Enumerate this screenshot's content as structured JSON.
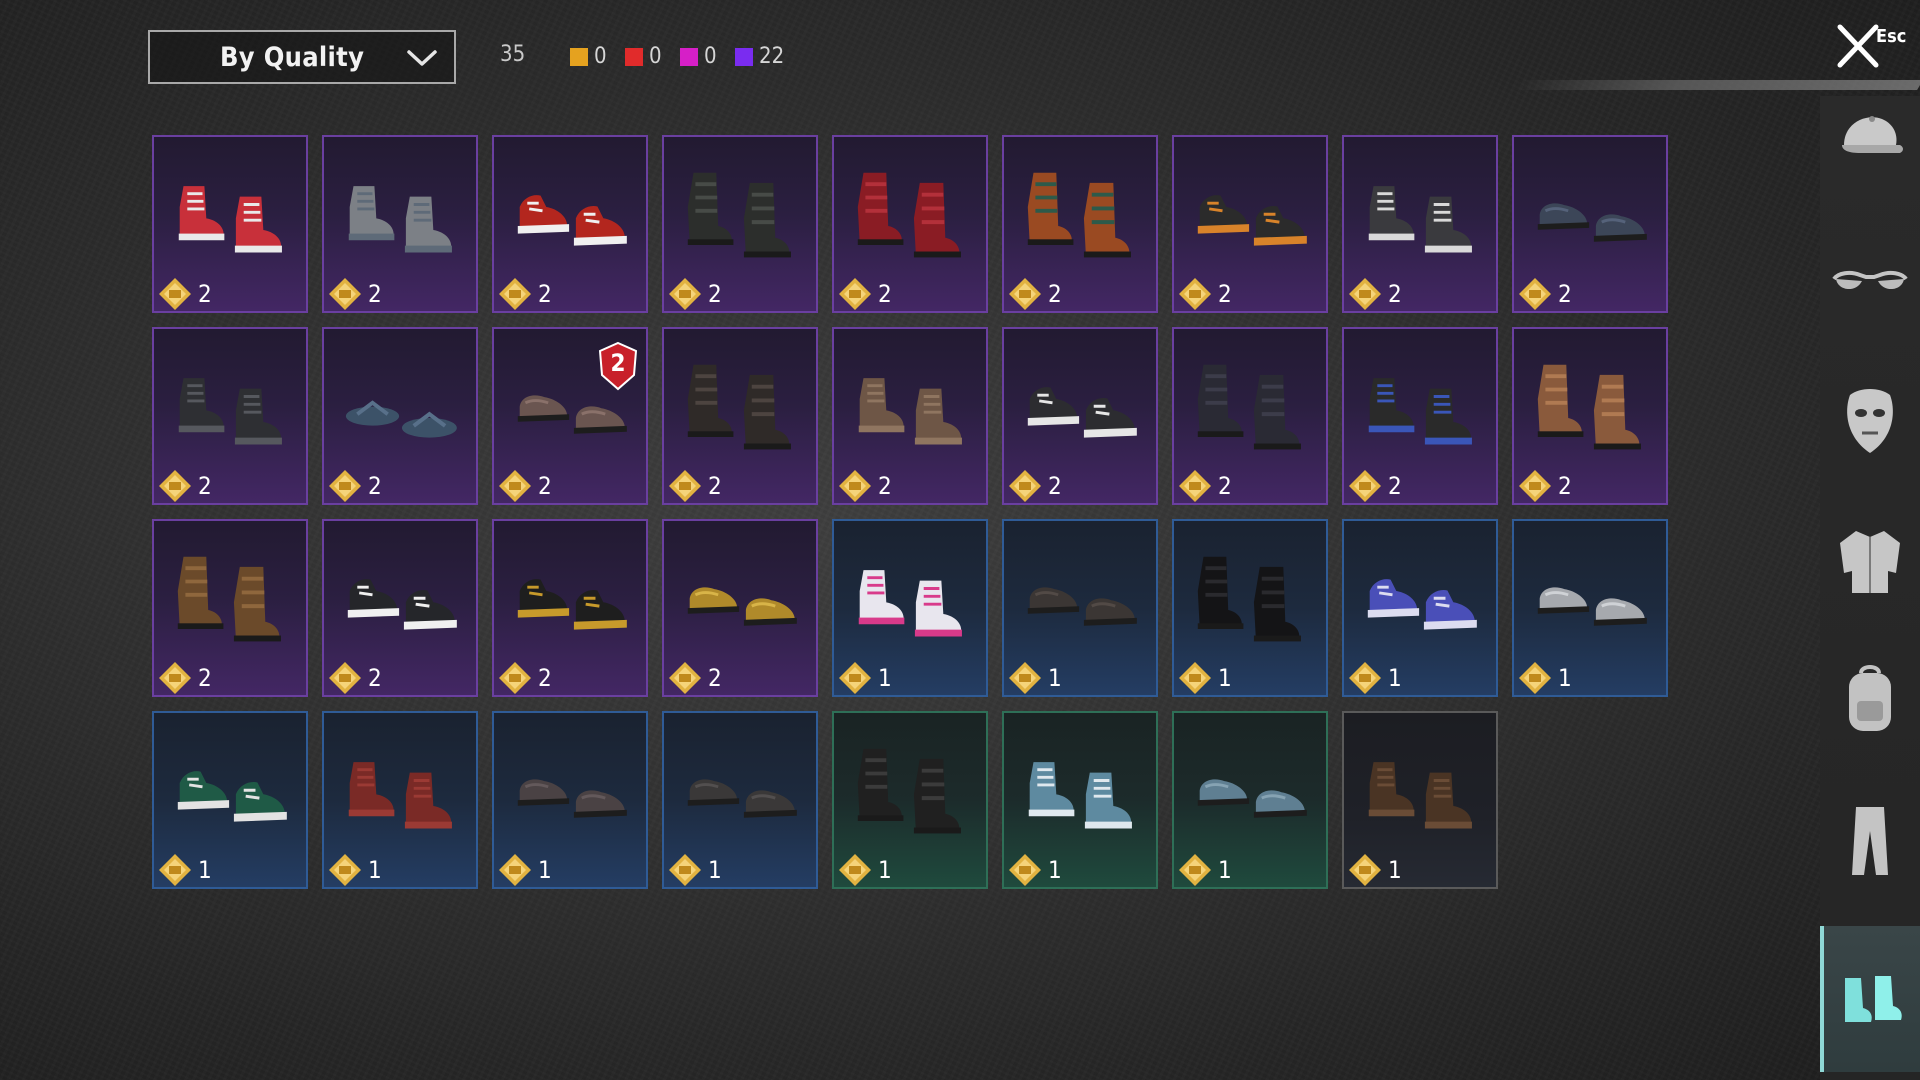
{
  "toolbar": {
    "sort_label": "By Quality",
    "total_count": "35",
    "legend": [
      {
        "color": "#e5a21f",
        "count": "0"
      },
      {
        "color": "#e12b2b",
        "count": "0"
      },
      {
        "color": "#d61fc7",
        "count": "0"
      },
      {
        "color": "#7a2cf0",
        "count": "22"
      }
    ]
  },
  "close": {
    "esc_label": "Esc"
  },
  "sidebar": {
    "items": [
      {
        "icon": "cap-icon",
        "active": false
      },
      {
        "icon": "glasses-icon",
        "active": false
      },
      {
        "icon": "mask-icon",
        "active": false
      },
      {
        "icon": "jacket-icon",
        "active": false
      },
      {
        "icon": "backpack-icon",
        "active": false
      },
      {
        "icon": "pants-icon",
        "active": false
      },
      {
        "icon": "shoes-icon",
        "active": true
      }
    ]
  },
  "items": [
    {
      "quality": "purple",
      "price": "2",
      "shoe": "high-top",
      "color": "#c8303a",
      "accent": "#e9e9e9"
    },
    {
      "quality": "purple",
      "price": "2",
      "shoe": "high-top",
      "color": "#7c8086",
      "accent": "#5e6a78"
    },
    {
      "quality": "purple",
      "price": "2",
      "shoe": "sneaker",
      "color": "#b3261e",
      "accent": "#f0f0f0"
    },
    {
      "quality": "purple",
      "price": "2",
      "shoe": "boot",
      "color": "#2c2e2c",
      "accent": "#474b47"
    },
    {
      "quality": "purple",
      "price": "2",
      "shoe": "boot",
      "color": "#8a1c24",
      "accent": "#b3303a"
    },
    {
      "quality": "purple",
      "price": "2",
      "shoe": "boot",
      "color": "#9a4a22",
      "accent": "#2d5a4a"
    },
    {
      "quality": "purple",
      "price": "2",
      "shoe": "sneaker",
      "color": "#2b2b2b",
      "accent": "#d8832a"
    },
    {
      "quality": "purple",
      "price": "2",
      "shoe": "high-top",
      "color": "#3a3a3e",
      "accent": "#d9d9d9"
    },
    {
      "quality": "purple",
      "price": "2",
      "shoe": "loafer",
      "color": "#3c4658",
      "accent": "#55627a"
    },
    {
      "quality": "purple",
      "price": "2",
      "shoe": "high-top",
      "color": "#2e2f33",
      "accent": "#56585e"
    },
    {
      "quality": "purple",
      "price": "2",
      "shoe": "sandal",
      "color": "#3c5268",
      "accent": "#58708a"
    },
    {
      "quality": "purple",
      "price": "2",
      "shoe": "loafer",
      "color": "#6a5550",
      "accent": "#8a716a",
      "badge": "2"
    },
    {
      "quality": "purple",
      "price": "2",
      "shoe": "boot",
      "color": "#2f2a28",
      "accent": "#4d4440"
    },
    {
      "quality": "purple",
      "price": "2",
      "shoe": "high-top",
      "color": "#6e5646",
      "accent": "#8f7560"
    },
    {
      "quality": "purple",
      "price": "2",
      "shoe": "sneaker",
      "color": "#2c2c30",
      "accent": "#e6e6e6"
    },
    {
      "quality": "purple",
      "price": "2",
      "shoe": "boot",
      "color": "#2a2a34",
      "accent": "#3c3c4a"
    },
    {
      "quality": "purple",
      "price": "2",
      "shoe": "high-top",
      "color": "#2a2a2a",
      "accent": "#3a56b8"
    },
    {
      "quality": "purple",
      "price": "2",
      "shoe": "boot",
      "color": "#8a5a3c",
      "accent": "#b07a52"
    },
    {
      "quality": "purple",
      "price": "2",
      "shoe": "boot",
      "color": "#6b4a2a",
      "accent": "#8f673d"
    },
    {
      "quality": "purple",
      "price": "2",
      "shoe": "sneaker",
      "color": "#25262a",
      "accent": "#f0f0f0"
    },
    {
      "quality": "purple",
      "price": "2",
      "shoe": "sneaker",
      "color": "#1e1e1e",
      "accent": "#c79a2b"
    },
    {
      "quality": "purple",
      "price": "2",
      "shoe": "loafer",
      "color": "#b08a2a",
      "accent": "#d8b448"
    },
    {
      "quality": "blue",
      "price": "1",
      "shoe": "high-top",
      "color": "#e8e6ee",
      "accent": "#d83a8a"
    },
    {
      "quality": "blue",
      "price": "1",
      "shoe": "loafer",
      "color": "#3b3634",
      "accent": "#524a46"
    },
    {
      "quality": "blue",
      "price": "1",
      "shoe": "boot",
      "color": "#141416",
      "accent": "#2a2a2e"
    },
    {
      "quality": "blue",
      "price": "1",
      "shoe": "sneaker",
      "color": "#4a4fb8",
      "accent": "#dcdcf0"
    },
    {
      "quality": "blue",
      "price": "1",
      "shoe": "loafer",
      "color": "#a6a9ae",
      "accent": "#cfd2d6"
    },
    {
      "quality": "blue",
      "price": "1",
      "shoe": "sneaker",
      "color": "#1f5a46",
      "accent": "#e3e3e3"
    },
    {
      "quality": "blue",
      "price": "1",
      "shoe": "high-top",
      "color": "#7a2a26",
      "accent": "#9b3a34"
    },
    {
      "quality": "blue",
      "price": "1",
      "shoe": "loafer",
      "color": "#4a4244",
      "accent": "#63595b"
    },
    {
      "quality": "blue",
      "price": "1",
      "shoe": "loafer",
      "color": "#3a3838",
      "accent": "#524f4f"
    },
    {
      "quality": "green",
      "price": "1",
      "shoe": "boot",
      "color": "#202020",
      "accent": "#3b3b3b"
    },
    {
      "quality": "green",
      "price": "1",
      "shoe": "high-top",
      "color": "#5e8aa0",
      "accent": "#dfe8ee"
    },
    {
      "quality": "green",
      "price": "1",
      "shoe": "loafer",
      "color": "#5f7f92",
      "accent": "#86a3b3"
    },
    {
      "quality": "gray",
      "price": "1",
      "shoe": "high-top",
      "color": "#4a3424",
      "accent": "#6a4c36"
    }
  ]
}
